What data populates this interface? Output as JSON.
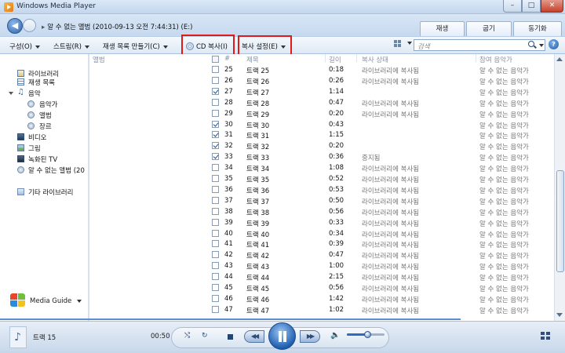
{
  "window": {
    "title": "Windows Media Player",
    "buttons": {
      "minimize": "–",
      "maximize": "□",
      "close": "✕"
    }
  },
  "nav": {
    "breadcrumb": [
      "알 수 없는 앨범 (2010-09-13 오전 7:44:31) (E:)"
    ]
  },
  "mode_tabs": [
    "재생",
    "굽기",
    "동기화"
  ],
  "toolbar": {
    "organize": "구성(O)",
    "stream": "스트림(R)",
    "create_playlist": "재생 목록 만들기(C)",
    "rip_cd": "CD 복사(I)",
    "rip_settings": "복사 설정(E)",
    "search_placeholder": "검색",
    "help": "?"
  },
  "sidebar": {
    "items": [
      {
        "label": "라이브러리",
        "icon": "library-icon"
      },
      {
        "label": "재생 목록",
        "icon": "playlist-icon"
      },
      {
        "label": "음악",
        "icon": "music-note-icon"
      },
      {
        "label": "음악가",
        "icon": "artist-icon"
      },
      {
        "label": "앨범",
        "icon": "album-icon"
      },
      {
        "label": "장르",
        "icon": "genre-icon"
      },
      {
        "label": "비디오",
        "icon": "video-icon"
      },
      {
        "label": "그림",
        "icon": "picture-icon"
      },
      {
        "label": "녹화된 TV",
        "icon": "tv-icon"
      },
      {
        "label": "알 수 없는 앨범 (20",
        "icon": "cd-icon"
      },
      {
        "label": "기타 라이브러리",
        "icon": "other-library-icon"
      }
    ],
    "media_guide": "Media Guide"
  },
  "columns": {
    "album": "앨범",
    "number": "#",
    "title": "제목",
    "length": "길이",
    "rip_status": "복사 상태",
    "contributing_artist": "참여 음악가"
  },
  "tracks": [
    {
      "num": "25",
      "title": "트랙 25",
      "length": "0:18",
      "status": "라이브러리에 복사됨",
      "artist": "알 수 없는 음악가",
      "checked": false
    },
    {
      "num": "26",
      "title": "트랙 26",
      "length": "0:26",
      "status": "라이브러리에 복사됨",
      "artist": "알 수 없는 음악가",
      "checked": false
    },
    {
      "num": "27",
      "title": "트랙 27",
      "length": "1:14",
      "status": "",
      "artist": "알 수 없는 음악가",
      "checked": true
    },
    {
      "num": "28",
      "title": "트랙 28",
      "length": "0:47",
      "status": "라이브러리에 복사됨",
      "artist": "알 수 없는 음악가",
      "checked": false
    },
    {
      "num": "29",
      "title": "트랙 29",
      "length": "0:20",
      "status": "라이브러리에 복사됨",
      "artist": "알 수 없는 음악가",
      "checked": false
    },
    {
      "num": "30",
      "title": "트랙 30",
      "length": "0:43",
      "status": "",
      "artist": "알 수 없는 음악가",
      "checked": true
    },
    {
      "num": "31",
      "title": "트랙 31",
      "length": "1:15",
      "status": "",
      "artist": "알 수 없는 음악가",
      "checked": true
    },
    {
      "num": "32",
      "title": "트랙 32",
      "length": "0:20",
      "status": "",
      "artist": "알 수 없는 음악가",
      "checked": true
    },
    {
      "num": "33",
      "title": "트랙 33",
      "length": "0:36",
      "status": "중지됨",
      "artist": "알 수 없는 음악가",
      "checked": true
    },
    {
      "num": "34",
      "title": "트랙 34",
      "length": "1:08",
      "status": "라이브러리에 복사됨",
      "artist": "알 수 없는 음악가",
      "checked": false
    },
    {
      "num": "35",
      "title": "트랙 35",
      "length": "0:52",
      "status": "라이브러리에 복사됨",
      "artist": "알 수 없는 음악가",
      "checked": false
    },
    {
      "num": "36",
      "title": "트랙 36",
      "length": "0:53",
      "status": "라이브러리에 복사됨",
      "artist": "알 수 없는 음악가",
      "checked": false
    },
    {
      "num": "37",
      "title": "트랙 37",
      "length": "0:50",
      "status": "라이브러리에 복사됨",
      "artist": "알 수 없는 음악가",
      "checked": false
    },
    {
      "num": "38",
      "title": "트랙 38",
      "length": "0:56",
      "status": "라이브러리에 복사됨",
      "artist": "알 수 없는 음악가",
      "checked": false
    },
    {
      "num": "39",
      "title": "트랙 39",
      "length": "0:33",
      "status": "라이브러리에 복사됨",
      "artist": "알 수 없는 음악가",
      "checked": false
    },
    {
      "num": "40",
      "title": "트랙 40",
      "length": "0:34",
      "status": "라이브러리에 복사됨",
      "artist": "알 수 없는 음악가",
      "checked": false
    },
    {
      "num": "41",
      "title": "트랙 41",
      "length": "0:39",
      "status": "라이브러리에 복사됨",
      "artist": "알 수 없는 음악가",
      "checked": false
    },
    {
      "num": "42",
      "title": "트랙 42",
      "length": "0:47",
      "status": "라이브러리에 복사됨",
      "artist": "알 수 없는 음악가",
      "checked": false
    },
    {
      "num": "43",
      "title": "트랙 43",
      "length": "1:00",
      "status": "라이브러리에 복사됨",
      "artist": "알 수 없는 음악가",
      "checked": false
    },
    {
      "num": "44",
      "title": "트랙 44",
      "length": "2:15",
      "status": "라이브러리에 복사됨",
      "artist": "알 수 없는 음악가",
      "checked": false
    },
    {
      "num": "45",
      "title": "트랙 45",
      "length": "0:56",
      "status": "라이브러리에 복사됨",
      "artist": "알 수 없는 음악가",
      "checked": false
    },
    {
      "num": "46",
      "title": "트랙 46",
      "length": "1:42",
      "status": "라이브러리에 복사됨",
      "artist": "알 수 없는 음악가",
      "checked": false
    },
    {
      "num": "47",
      "title": "트랙 47",
      "length": "1:02",
      "status": "라이브러리에 복사됨",
      "artist": "알 수 없는 음악가",
      "checked": false
    }
  ],
  "player": {
    "now_playing": "트랙 15",
    "time": "00:50",
    "volume": 0.55
  }
}
